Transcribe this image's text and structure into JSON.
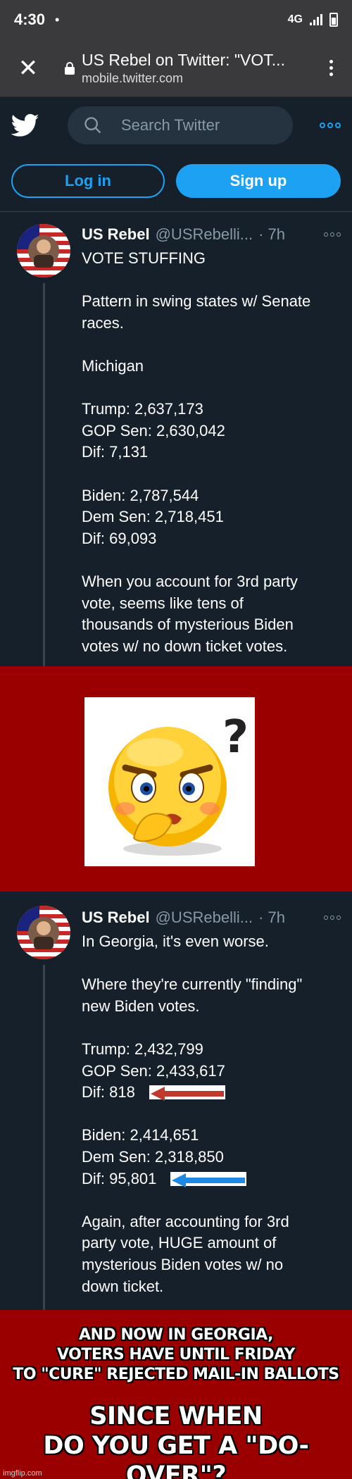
{
  "status_bar": {
    "time": "4:30",
    "dot": "•",
    "network": "4G"
  },
  "browser": {
    "title": "US Rebel on Twitter: \"VOT...",
    "domain": "mobile.twitter.com",
    "close_label": "✕"
  },
  "header": {
    "search_placeholder": "Search Twitter"
  },
  "auth": {
    "login_label": "Log in",
    "signup_label": "Sign up"
  },
  "tweets": [
    {
      "name": "US Rebel",
      "handle": "@USRebelli...",
      "time": "· 7h",
      "lines": [
        "VOTE STUFFING",
        "",
        "Pattern in swing states w/ Senate",
        "races.",
        "",
        "Michigan",
        "",
        "Trump: 2,637,173",
        "GOP Sen: 2,630,042",
        "Dif: 7,131",
        "",
        "Biden: 2,787,544",
        "Dem Sen: 2,718,451",
        "Dif: 69,093",
        "",
        "When you account for 3rd party",
        "vote, seems like tens of",
        "thousands of mysterious Biden",
        "votes w/ no down ticket votes."
      ]
    },
    {
      "name": "US Rebel",
      "handle": "@USRebelli...",
      "time": "· 7h",
      "lines": [
        "In Georgia, it's even worse.",
        "",
        "Where they're currently \"finding\"",
        "new Biden votes.",
        "",
        "Trump: 2,432,799",
        "GOP Sen: 2,433,617",
        "Dif: 818",
        "",
        "Biden: 2,414,651",
        "Dem Sen: 2,318,850",
        "Dif: 95,801",
        "",
        "Again, after accounting for 3rd",
        "party vote, HUGE amount of",
        "mysterious Biden votes w/ no",
        "down ticket."
      ]
    }
  ],
  "emoji_question_mark": "?",
  "banner": {
    "line1": [
      "AND NOW IN GEORGIA,",
      "VOTERS HAVE UNTIL FRIDAY",
      "TO \"CURE\" REJECTED MAIL-IN BALLOTS"
    ],
    "line2": [
      "SINCE WHEN",
      "DO YOU GET A \"DO-OVER\"?"
    ]
  },
  "watermark": "imgflip.com",
  "colors": {
    "accent": "#1da1f2",
    "background": "#15202b",
    "banner_red": "#9b0000",
    "arrow_red": "#c0392b",
    "arrow_blue": "#1e88e5"
  }
}
